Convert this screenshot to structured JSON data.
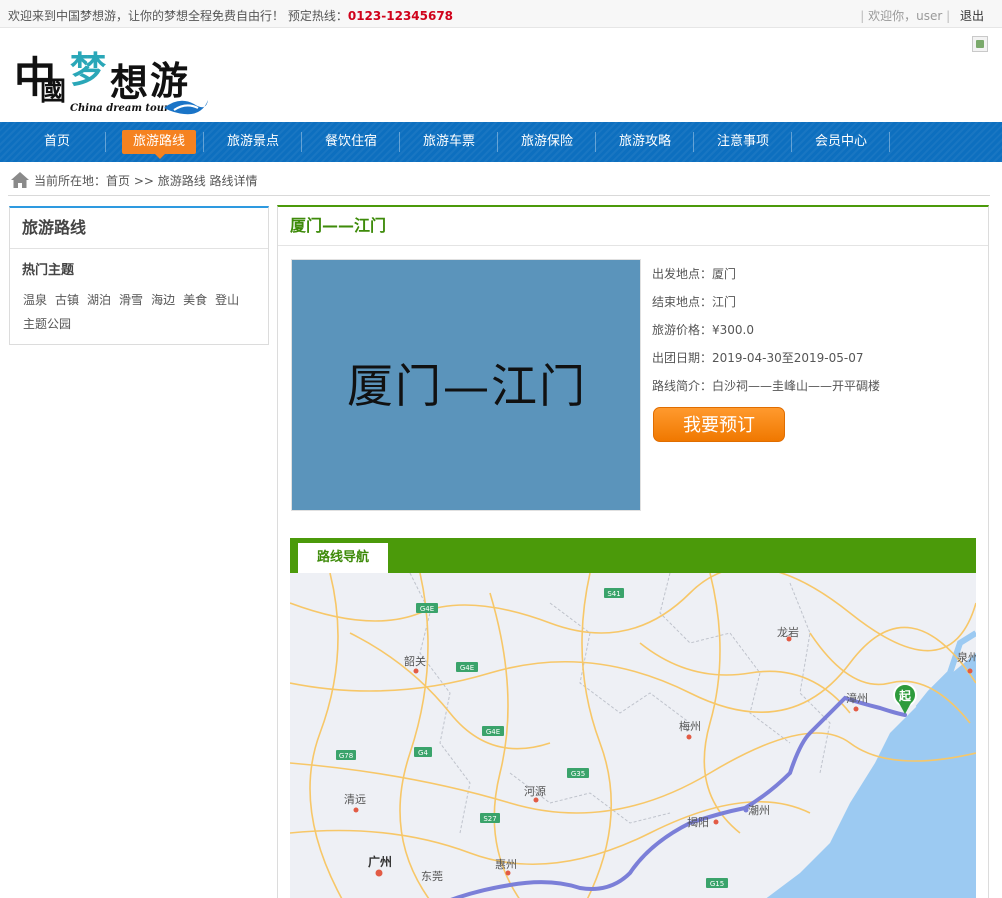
{
  "topbar": {
    "welcome": "欢迎来到中国梦想游，让你的梦想全程免费自由行！",
    "hotline_label": "预定热线：",
    "hotline": "0123-12345678",
    "greeting": "欢迎你，user",
    "logout": "退出"
  },
  "logo": {
    "main": "中國梦想游",
    "sub": "China dream tour"
  },
  "nav": {
    "items": [
      "首页",
      "旅游路线",
      "旅游景点",
      "餐饮住宿",
      "旅游车票",
      "旅游保险",
      "旅游攻略",
      "注意事项",
      "会员中心"
    ],
    "active": "旅游路线"
  },
  "breadcrumb": {
    "text": "当前所在地：首页 >> 旅游路线 路线详情"
  },
  "sidebar": {
    "title": "旅游路线",
    "subtitle": "热门主题",
    "tags": [
      "温泉",
      "古镇",
      "湖泊",
      "滑雪",
      "海边",
      "美食",
      "登山",
      "主题公园"
    ]
  },
  "route": {
    "title": "厦门——江门",
    "cover_text": "厦门—江门",
    "departure_label": "出发地点：",
    "departure": "厦门",
    "destination_label": "结束地点：",
    "destination": "江门",
    "price_label": "旅游价格：",
    "price": "¥300.0",
    "date_label": "出团日期：",
    "date": "2019-04-30至2019-05-07",
    "intro_label": "路线简介：",
    "intro": "白沙祠——圭峰山——开平碉楼",
    "book_button": "我要预订"
  },
  "map_section": {
    "tab": "路线导航",
    "start_marker": "起",
    "cities": [
      "韶关",
      "龙岩",
      "泉州",
      "漳州",
      "梅州",
      "河源",
      "清远",
      "揭阳",
      "潮州",
      "广州",
      "惠州",
      "东莞"
    ],
    "roads": [
      "G4E",
      "S41",
      "G4E",
      "G4E",
      "G78",
      "G4",
      "G35",
      "S27",
      "G15"
    ]
  },
  "colors": {
    "nav": "#0d6fbf",
    "active": "#f58220",
    "green": "#4b9a0a",
    "sidebar_top": "#2e9ae0",
    "cover": "#5b94bb"
  }
}
